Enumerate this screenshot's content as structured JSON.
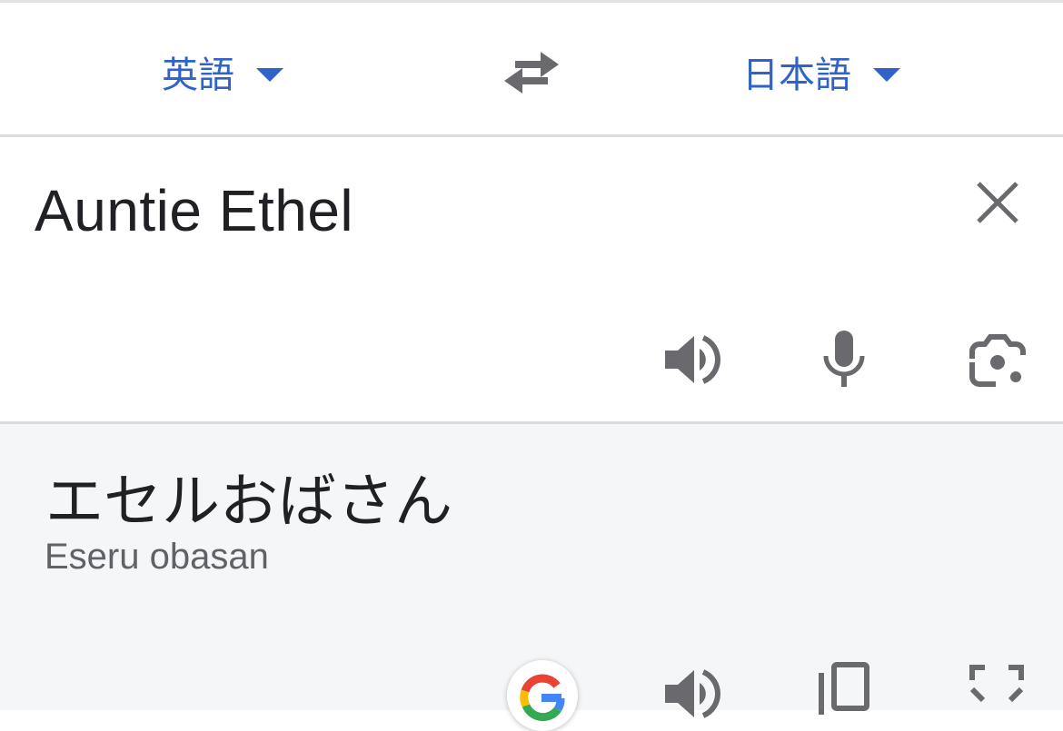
{
  "header": {
    "source_language": "英語",
    "target_language": "日本語"
  },
  "input": {
    "text": "Auntie Ethel"
  },
  "output": {
    "translation": "エセルおばさん",
    "romanization": "Eseru obasan"
  },
  "icons": {
    "swap": "swap-arrows-icon",
    "clear": "close-icon",
    "listen_source": "speaker-icon",
    "voice_input": "microphone-icon",
    "camera": "camera-lens-icon",
    "google": "google-logo-icon",
    "listen_target": "speaker-icon",
    "copy": "copy-icon",
    "fullscreen": "fullscreen-icon"
  },
  "colors": {
    "accent": "#2f63c8",
    "icon_gray": "#6a6a6e",
    "output_background": "#f5f6f8"
  }
}
